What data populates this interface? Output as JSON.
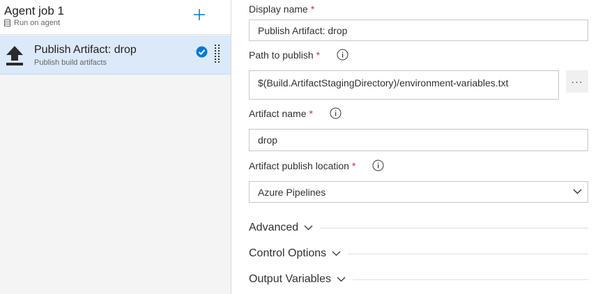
{
  "job": {
    "title": "Agent job 1",
    "subtitle": "Run on agent"
  },
  "task": {
    "title": "Publish Artifact: drop",
    "subtitle": "Publish build artifacts"
  },
  "form": {
    "display_name": {
      "label": "Display name",
      "required": "*",
      "value": "Publish Artifact: drop"
    },
    "path_to_publish": {
      "label": "Path to publish",
      "required": "*",
      "value": "$(Build.ArtifactStagingDirectory)/environment-variables.txt",
      "more": "···"
    },
    "artifact_name": {
      "label": "Artifact name",
      "required": "*",
      "value": "drop"
    },
    "publish_location": {
      "label": "Artifact publish location",
      "required": "*",
      "value": "Azure Pipelines"
    }
  },
  "sections": {
    "advanced": "Advanced",
    "control_options": "Control Options",
    "output_variables": "Output Variables"
  },
  "colors": {
    "accent": "#0078d4",
    "selected_row": "#dbe9f9",
    "required": "#c4314b"
  }
}
